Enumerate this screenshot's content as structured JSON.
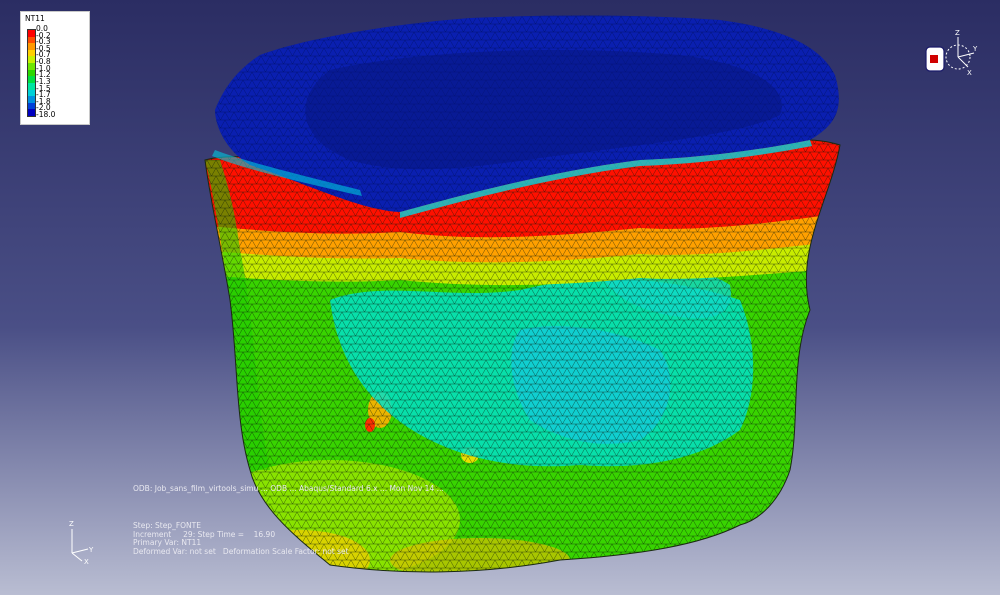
{
  "legend": {
    "title": "NT11",
    "labels": [
      "0.0",
      "-0.2",
      "-0.3",
      "-0.5",
      "-0.7",
      "-0.8",
      "-1.0",
      "-1.2",
      "-1.3",
      "-1.5",
      "-1.7",
      "-1.8",
      "-2.0",
      "-18.0"
    ],
    "colors": [
      "#ff0000",
      "#ff4c00",
      "#ff9900",
      "#ffd000",
      "#c8f000",
      "#6ee600",
      "#2cd800",
      "#00e040",
      "#00e6a0",
      "#00d0d8",
      "#0090e0",
      "#0040d8",
      "#0000c0"
    ]
  },
  "odb_line": "ODB: Job_sans_film_virtools_simu ... ODB ... Abaqus/Standard 6.x ... Mon Nov 14 ...",
  "info": {
    "step": "Step: Step_FONTE",
    "increment": "Increment     29: Step Time =    16.90",
    "primary": "Primary Var: NT11",
    "deformed": "Deformed Var: not set   Deformation Scale Factor: not set"
  },
  "triad_left": {
    "z": "Z",
    "y": "Y",
    "x": "X"
  },
  "triad_right": {
    "z": "Z",
    "y": "Y",
    "x": "X"
  },
  "colors": {
    "background_top": "#2b2d63",
    "background_bottom": "#b9bdd2",
    "top_face": "#0a1fb0"
  }
}
